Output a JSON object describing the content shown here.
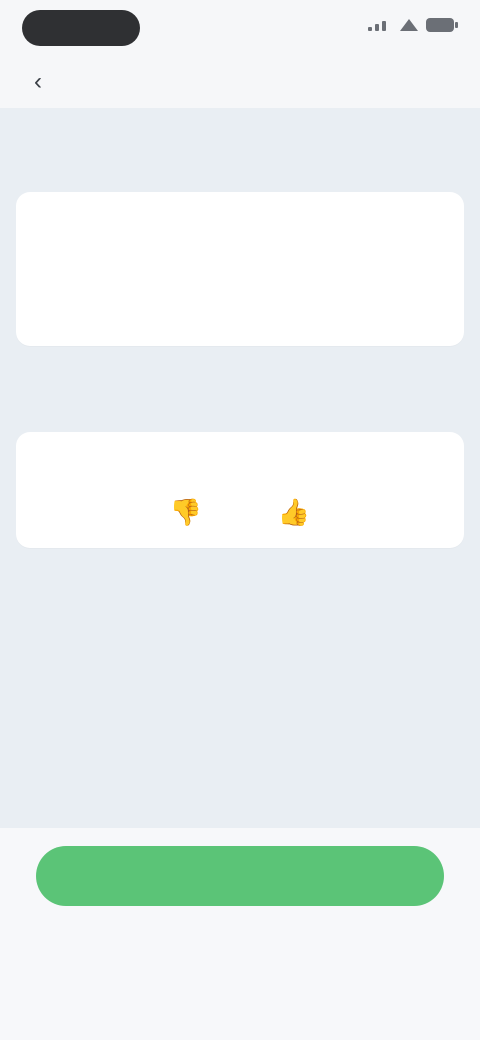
{
  "status_bar": {
    "icons": [
      "signal-icon",
      "wifi-icon",
      "battery-icon"
    ]
  },
  "header": {
    "title": "",
    "back_icon": "chevron-left-icon"
  },
  "sections": {
    "summary": {
      "title": "",
      "text": ""
    },
    "feedback": {
      "title": "",
      "prompt": "",
      "dislike_icon": "thumbs-down-icon",
      "like_icon": "thumbs-up-icon"
    }
  },
  "actions": {
    "primary_label": "",
    "secondary_label": ""
  },
  "colors": {
    "primary": "#5bc477",
    "dislike": "#e06b7d",
    "like": "#8cd494",
    "background": "#e9eef3"
  }
}
